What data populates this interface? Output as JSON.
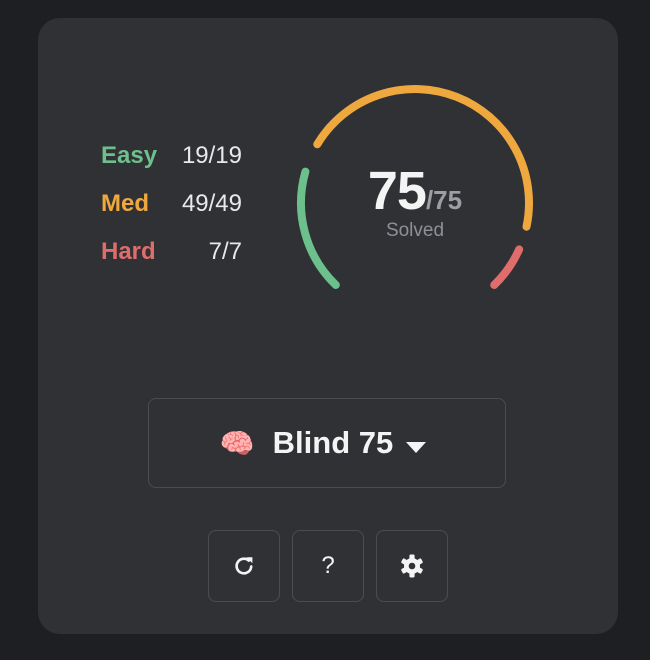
{
  "stats": [
    {
      "label": "Easy",
      "value": "19/19",
      "color": "#6cc08b"
    },
    {
      "label": "Med",
      "value": "49/49",
      "color": "#eea83e"
    },
    {
      "label": "Hard",
      "value": "7/7",
      "color": "#e06c6c"
    }
  ],
  "gauge": {
    "solved": "75",
    "total": "/75",
    "caption": "Solved",
    "progress_fraction": 1.0
  },
  "list_selector": {
    "icon": "🧠",
    "label": "Blind 75"
  },
  "buttons": {
    "refresh_icon": "refresh-icon",
    "help_label": "?",
    "settings_icon": "gear-icon"
  }
}
